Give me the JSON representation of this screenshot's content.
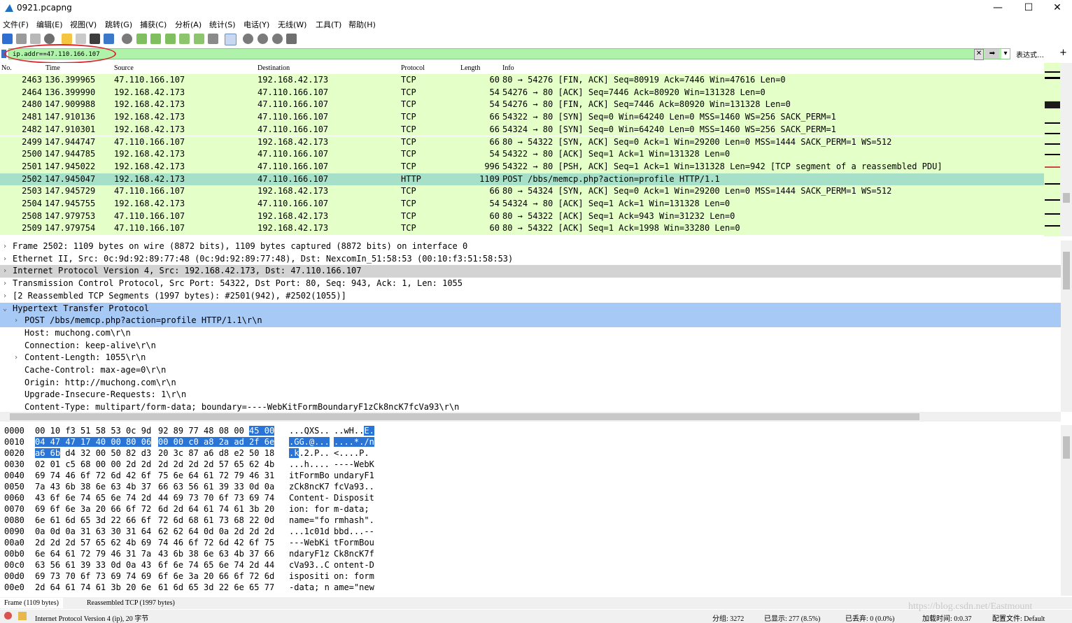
{
  "window": {
    "title": "0921.pcapng",
    "minimize": "—",
    "maximize": "☐",
    "close": "✕"
  },
  "menu": [
    "文件(F)",
    "编辑(E)",
    "视图(V)",
    "跳转(G)",
    "捕获(C)",
    "分析(A)",
    "统计(S)",
    "电话(Y)",
    "无线(W)",
    "工具(T)",
    "帮助(H)"
  ],
  "filter": {
    "value": "ip.addr==47.110.166.107",
    "expression_label": "表达式…",
    "add_label": "+"
  },
  "packet_list": {
    "columns": [
      "No.",
      "Time",
      "Source",
      "Destination",
      "Protocol",
      "Length",
      "Info"
    ],
    "rows": [
      {
        "no": "2463",
        "time": "136.399965",
        "src": "47.110.166.107",
        "dst": "192.168.42.173",
        "proto": "TCP",
        "len": "60",
        "info": "80 → 54276 [FIN, ACK] Seq=80919 Ack=7446 Win=47616 Len=0"
      },
      {
        "no": "2464",
        "time": "136.399990",
        "src": "192.168.42.173",
        "dst": "47.110.166.107",
        "proto": "TCP",
        "len": "54",
        "info": "54276 → 80 [ACK] Seq=7446 Ack=80920 Win=131328 Len=0"
      },
      {
        "no": "2480",
        "time": "147.909988",
        "src": "192.168.42.173",
        "dst": "47.110.166.107",
        "proto": "TCP",
        "len": "54",
        "info": "54276 → 80 [FIN, ACK] Seq=7446 Ack=80920 Win=131328 Len=0"
      },
      {
        "no": "2481",
        "time": "147.910136",
        "src": "192.168.42.173",
        "dst": "47.110.166.107",
        "proto": "TCP",
        "len": "66",
        "info": "54322 → 80 [SYN] Seq=0 Win=64240 Len=0 MSS=1460 WS=256 SACK_PERM=1"
      },
      {
        "no": "2482",
        "time": "147.910301",
        "src": "192.168.42.173",
        "dst": "47.110.166.107",
        "proto": "TCP",
        "len": "66",
        "info": "54324 → 80 [SYN] Seq=0 Win=64240 Len=0 MSS=1460 WS=256 SACK_PERM=1"
      },
      {
        "no": "2499",
        "time": "147.944747",
        "src": "47.110.166.107",
        "dst": "192.168.42.173",
        "proto": "TCP",
        "len": "66",
        "info": "80 → 54322 [SYN, ACK] Seq=0 Ack=1 Win=29200 Len=0 MSS=1444 SACK_PERM=1 WS=512"
      },
      {
        "no": "2500",
        "time": "147.944785",
        "src": "192.168.42.173",
        "dst": "47.110.166.107",
        "proto": "TCP",
        "len": "54",
        "info": "54322 → 80 [ACK] Seq=1 Ack=1 Win=131328 Len=0"
      },
      {
        "no": "2501",
        "time": "147.945022",
        "src": "192.168.42.173",
        "dst": "47.110.166.107",
        "proto": "TCP",
        "len": "996",
        "info": "54322 → 80 [PSH, ACK] Seq=1 Ack=1 Win=131328 Len=942 [TCP segment of a reassembled PDU]"
      },
      {
        "no": "2502",
        "time": "147.945047",
        "src": "192.168.42.173",
        "dst": "47.110.166.107",
        "proto": "HTTP",
        "len": "1109",
        "info": "POST /bbs/memcp.php?action=profile HTTP/1.1",
        "selected": true
      },
      {
        "no": "2503",
        "time": "147.945729",
        "src": "47.110.166.107",
        "dst": "192.168.42.173",
        "proto": "TCP",
        "len": "66",
        "info": "80 → 54324 [SYN, ACK] Seq=0 Ack=1 Win=29200 Len=0 MSS=1444 SACK_PERM=1 WS=512"
      },
      {
        "no": "2504",
        "time": "147.945755",
        "src": "192.168.42.173",
        "dst": "47.110.166.107",
        "proto": "TCP",
        "len": "54",
        "info": "54324 → 80 [ACK] Seq=1 Ack=1 Win=131328 Len=0"
      },
      {
        "no": "2508",
        "time": "147.979753",
        "src": "47.110.166.107",
        "dst": "192.168.42.173",
        "proto": "TCP",
        "len": "60",
        "info": "80 → 54322 [ACK] Seq=1 Ack=943 Win=31232 Len=0"
      },
      {
        "no": "2509",
        "time": "147.979754",
        "src": "47.110.166.107",
        "dst": "192.168.42.173",
        "proto": "TCP",
        "len": "60",
        "info": "80 → 54322 [ACK] Seq=1 Ack=1998 Win=33280 Len=0"
      }
    ]
  },
  "details": [
    {
      "arrow": "›",
      "indent": 0,
      "text": "Frame 2502: 1109 bytes on wire (8872 bits), 1109 bytes captured (8872 bits) on interface 0",
      "style": ""
    },
    {
      "arrow": "›",
      "indent": 0,
      "text": "Ethernet II, Src: 0c:9d:92:89:77:48 (0c:9d:92:89:77:48), Dst: NexcomIn_51:58:53 (00:10:f3:51:58:53)",
      "style": ""
    },
    {
      "arrow": "›",
      "indent": 0,
      "text": "Internet Protocol Version 4, Src: 192.168.42.173, Dst: 47.110.166.107",
      "style": "grey"
    },
    {
      "arrow": "›",
      "indent": 0,
      "text": "Transmission Control Protocol, Src Port: 54322, Dst Port: 80, Seq: 943, Ack: 1, Len: 1055",
      "style": ""
    },
    {
      "arrow": "›",
      "indent": 0,
      "text": "[2 Reassembled TCP Segments (1997 bytes): #2501(942), #2502(1055)]",
      "style": ""
    },
    {
      "arrow": "⌄",
      "indent": 0,
      "text": "Hypertext Transfer Protocol",
      "style": "blue"
    },
    {
      "arrow": "›",
      "indent": 1,
      "text": "POST /bbs/memcp.php?action=profile HTTP/1.1\\r\\n",
      "style": "blue"
    },
    {
      "arrow": "",
      "indent": 1,
      "text": "Host: muchong.com\\r\\n",
      "style": ""
    },
    {
      "arrow": "",
      "indent": 1,
      "text": "Connection: keep-alive\\r\\n",
      "style": ""
    },
    {
      "arrow": "›",
      "indent": 1,
      "text": "Content-Length: 1055\\r\\n",
      "style": ""
    },
    {
      "arrow": "",
      "indent": 1,
      "text": "Cache-Control: max-age=0\\r\\n",
      "style": ""
    },
    {
      "arrow": "",
      "indent": 1,
      "text": "Origin: http://muchong.com\\r\\n",
      "style": ""
    },
    {
      "arrow": "",
      "indent": 1,
      "text": "Upgrade-Insecure-Requests: 1\\r\\n",
      "style": ""
    },
    {
      "arrow": "",
      "indent": 1,
      "text": "Content-Type: multipart/form-data; boundary=----WebKitFormBoundaryF1zCk8ncK7fcVa93\\r\\n",
      "style": ""
    }
  ],
  "hex": [
    {
      "off": "0000",
      "b1": "00 10 f3 51 58 53 0c 9d",
      "b2": "92 89 77 48 08 00 45 00",
      "a1": "...QXS..",
      "a2": "..wH..E."
    },
    {
      "off": "0010",
      "b1": "04 47 47 17 40 00 80 06",
      "b2": "00 00 c0 a8 2a ad 2f 6e",
      "a1": ".GG.@...",
      "a2": "....*./n"
    },
    {
      "off": "0020",
      "b1": "a6 6b d4 32 00 50 82 d3",
      "b2": "20 3c 87 a6 d8 e2 50 18",
      "a1": ".k.2.P..",
      "a2": " <....P."
    },
    {
      "off": "0030",
      "b1": "02 01 c5 68 00 00 2d 2d",
      "b2": "2d 2d 2d 2d 57 65 62 4b",
      "a1": "...h....",
      "a2": "----WebK"
    },
    {
      "off": "0040",
      "b1": "69 74 46 6f 72 6d 42 6f",
      "b2": "75 6e 64 61 72 79 46 31",
      "a1": "itFormBo",
      "a2": "undaryF1"
    },
    {
      "off": "0050",
      "b1": "7a 43 6b 38 6e 63 4b 37",
      "b2": "66 63 56 61 39 33 0d 0a",
      "a1": "zCk8ncK7",
      "a2": "fcVa93.."
    },
    {
      "off": "0060",
      "b1": "43 6f 6e 74 65 6e 74 2d",
      "b2": "44 69 73 70 6f 73 69 74",
      "a1": "Content-",
      "a2": "Disposit"
    },
    {
      "off": "0070",
      "b1": "69 6f 6e 3a 20 66 6f 72",
      "b2": "6d 2d 64 61 74 61 3b 20",
      "a1": "ion: for",
      "a2": "m-data; "
    },
    {
      "off": "0080",
      "b1": "6e 61 6d 65 3d 22 66 6f",
      "b2": "72 6d 68 61 73 68 22 0d",
      "a1": "name=\"fo",
      "a2": "rmhash\"."
    },
    {
      "off": "0090",
      "b1": "0a 0d 0a 31 63 30 31 64",
      "b2": "62 62 64 0d 0a 2d 2d 2d",
      "a1": "...1c01d",
      "a2": "bbd...--"
    },
    {
      "off": "00a0",
      "b1": "2d 2d 2d 57 65 62 4b 69",
      "b2": "74 46 6f 72 6d 42 6f 75",
      "a1": "---WebKi",
      "a2": "tFormBou"
    },
    {
      "off": "00b0",
      "b1": "6e 64 61 72 79 46 31 7a",
      "b2": "43 6b 38 6e 63 4b 37 66",
      "a1": "ndaryF1z",
      "a2": "Ck8ncK7f"
    },
    {
      "off": "00c0",
      "b1": "63 56 61 39 33 0d 0a 43",
      "b2": "6f 6e 74 65 6e 74 2d 44",
      "a1": "cVa93..C",
      "a2": "ontent-D"
    },
    {
      "off": "00d0",
      "b1": "69 73 70 6f 73 69 74 69",
      "b2": "6f 6e 3a 20 66 6f 72 6d",
      "a1": "ispositi",
      "a2": "on: form"
    },
    {
      "off": "00e0",
      "b1": "2d 64 61 74 61 3b 20 6e",
      "b2": "61 6d 65 3d 22 6e 65 77",
      "a1": "-data; n",
      "a2": "ame=\"new"
    }
  ],
  "tabs": [
    "Frame (1109 bytes)",
    "Reassembled TCP (1997 bytes)"
  ],
  "status": {
    "left": "Internet Protocol Version 4 (ip), 20 字节",
    "groups": "分组: 3272",
    "shown": "已显示: 277 (8.5%)",
    "dropped": "已丢弃: 0 (0.0%)",
    "load_time": "加载时间: 0:0.37",
    "profile": "配置文件: Default",
    "watermark": "https://blog.csdn.net/Eastmount"
  },
  "colors": {
    "row_bg": "#e4ffc7",
    "selected_row_bg": "#a7e0c8",
    "http_expanded_bg": "#a7c9f5",
    "hex_highlight": "#2a74d5",
    "filter_bg": "#aff2aa",
    "annotation_ellipse": "#d9262b"
  }
}
